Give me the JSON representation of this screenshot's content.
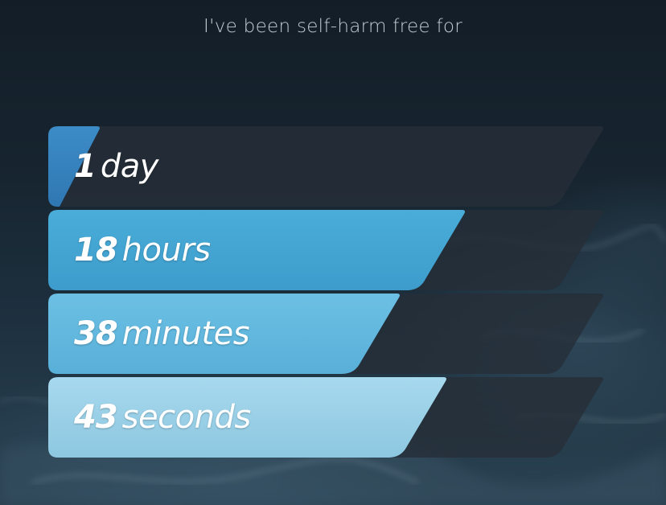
{
  "headline": "I've been self-harm free for",
  "counters": [
    {
      "key": "days",
      "value": "1",
      "unit": "day",
      "fill": 0.033,
      "color_top": "#3c8cc8",
      "color_bottom": "#2f77b2"
    },
    {
      "key": "hours",
      "value": "18",
      "unit": "hours",
      "fill": 0.75,
      "color_top": "#4aadd9",
      "color_bottom": "#3d9ccb"
    },
    {
      "key": "minutes",
      "value": "38",
      "unit": "minutes",
      "fill": 0.633,
      "color_top": "#6cc0e4",
      "color_bottom": "#58afd8"
    },
    {
      "key": "seconds",
      "value": "43",
      "unit": "seconds",
      "fill": 0.717,
      "color_top": "#a7d9ee",
      "color_bottom": "#8dc7e0"
    }
  ],
  "track_color": "rgba(38,46,56,0.82)"
}
